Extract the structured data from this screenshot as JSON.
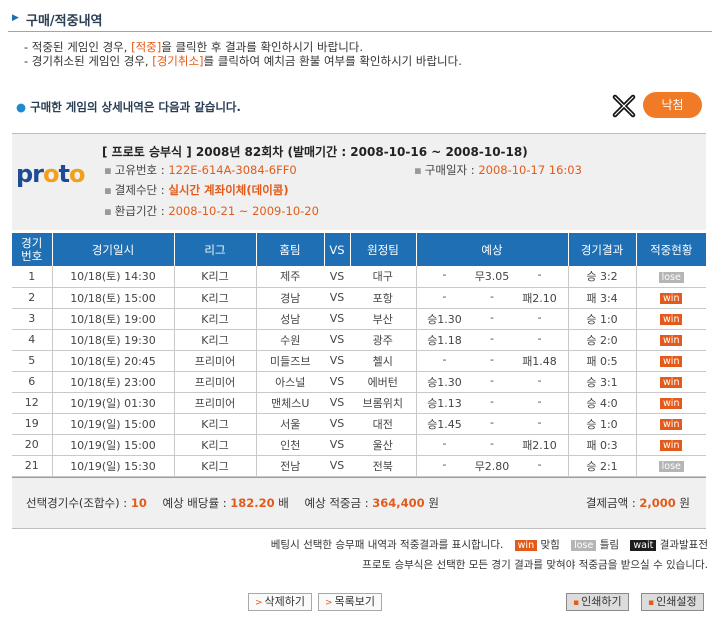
{
  "header": {
    "title": "구매/적중내역"
  },
  "notes": {
    "line1_pre": "- 적중된 게임인 경우, ",
    "line1_link": "[적중]",
    "line1_post": "을 클릭한 후 결과를 확인하시기 바랍니다.",
    "line2_pre": "- 경기취소된 게임인 경우, ",
    "line2_link": "[경기취소]",
    "line2_post": "를 클릭하여 예치금 환불 여부를 확인하시기 바랍니다."
  },
  "summary": {
    "text": "구매한 게임의 상세내역은 다음과 같습니다.",
    "fail_label": "낙첨"
  },
  "info": {
    "logo_text": "proto",
    "title": "[ 프로토 승부식 ] 2008년 82회차 (발매기간 : 2008-10-16 ~ 2008-10-18)",
    "id_label": "고유번호 :",
    "id_value": "122E-614A-3084-6FF0",
    "date_label": "구매일자 :",
    "date_value": "2008-10-17 16:03",
    "pay_label": "결제수단 :",
    "pay_value": "실시간 계좌이체(데이콤)",
    "refund_label": "환급기간 :",
    "refund_value": "2008-10-21 ~ 2009-10-20"
  },
  "table": {
    "headers": {
      "no": "경기\n번호",
      "date": "경기일시",
      "league": "리그",
      "home": "홈팀",
      "vs": "VS",
      "away": "원정팀",
      "pred": "예상",
      "result": "경기결과",
      "status": "적중현황"
    },
    "rows": [
      {
        "no": "1",
        "date": "10/18(토) 14:30",
        "league": "K리그",
        "home": "제주",
        "vs": "VS",
        "away": "대구",
        "p1": "-",
        "p2": "무3.05",
        "p3": "-",
        "result": "승 3:2",
        "status": "lose"
      },
      {
        "no": "2",
        "date": "10/18(토) 15:00",
        "league": "K리그",
        "home": "경남",
        "vs": "VS",
        "away": "포항",
        "p1": "-",
        "p2": "-",
        "p3": "패2.10",
        "result": "패 3:4",
        "status": "win"
      },
      {
        "no": "3",
        "date": "10/18(토) 19:00",
        "league": "K리그",
        "home": "성남",
        "vs": "VS",
        "away": "부산",
        "p1": "승1.30",
        "p2": "-",
        "p3": "-",
        "result": "승 1:0",
        "status": "win"
      },
      {
        "no": "4",
        "date": "10/18(토) 19:30",
        "league": "K리그",
        "home": "수원",
        "vs": "VS",
        "away": "광주",
        "p1": "승1.18",
        "p2": "-",
        "p3": "-",
        "result": "승 2:0",
        "status": "win"
      },
      {
        "no": "5",
        "date": "10/18(토) 20:45",
        "league": "프리미어",
        "home": "미들즈브",
        "vs": "VS",
        "away": "첼시",
        "p1": "-",
        "p2": "-",
        "p3": "패1.48",
        "result": "패 0:5",
        "status": "win"
      },
      {
        "no": "6",
        "date": "10/18(토) 23:00",
        "league": "프리미어",
        "home": "아스널",
        "vs": "VS",
        "away": "에버턴",
        "p1": "승1.30",
        "p2": "-",
        "p3": "-",
        "result": "승 3:1",
        "status": "win"
      },
      {
        "no": "12",
        "date": "10/19(일) 01:30",
        "league": "프리미어",
        "home": "맨체스U",
        "vs": "VS",
        "away": "브롬위치",
        "p1": "승1.13",
        "p2": "-",
        "p3": "-",
        "result": "승 4:0",
        "status": "win"
      },
      {
        "no": "19",
        "date": "10/19(일) 15:00",
        "league": "K리그",
        "home": "서울",
        "vs": "VS",
        "away": "대전",
        "p1": "승1.45",
        "p2": "-",
        "p3": "-",
        "result": "승 1:0",
        "status": "win"
      },
      {
        "no": "20",
        "date": "10/19(일) 15:00",
        "league": "K리그",
        "home": "인천",
        "vs": "VS",
        "away": "울산",
        "p1": "-",
        "p2": "-",
        "p3": "패2.10",
        "result": "패 0:3",
        "status": "win"
      },
      {
        "no": "21",
        "date": "10/19(일) 15:30",
        "league": "K리그",
        "home": "전남",
        "vs": "VS",
        "away": "전북",
        "p1": "-",
        "p2": "무2.80",
        "p3": "-",
        "result": "승 2:1",
        "status": "lose"
      }
    ]
  },
  "totals": {
    "count_label": "선택경기수(조합수) :",
    "count_value": "10",
    "odds_label": "예상 배당률 :",
    "odds_value": "182.20",
    "odds_unit": "배",
    "expected_label": "예상 적중금 :",
    "expected_value": "364,400",
    "expected_unit": "원",
    "paid_label": "결제금액 :",
    "paid_value": "2,000",
    "paid_unit": "원"
  },
  "legend": {
    "intro": "베팅시 선택한 승무패 내역과 적중결과를 표시합니다.",
    "win_badge": "win",
    "win_text": "맞힘",
    "lose_badge": "lose",
    "lose_text": "틀림",
    "wait_badge": "wait",
    "wait_text": "결과발표전",
    "note": "프로토 승부식은 선택한 모든 경기 결과를 맞혀야 적중금을 받으실 수 있습니다."
  },
  "buttons": {
    "delete": "삭제하기",
    "list": "목록보기",
    "print": "인쇄하기",
    "print_settings": "인쇄설정"
  },
  "colors": {
    "accent": "#e35b1a",
    "header_blue": "#1f6fb5",
    "fail_orange": "#f07a25"
  }
}
